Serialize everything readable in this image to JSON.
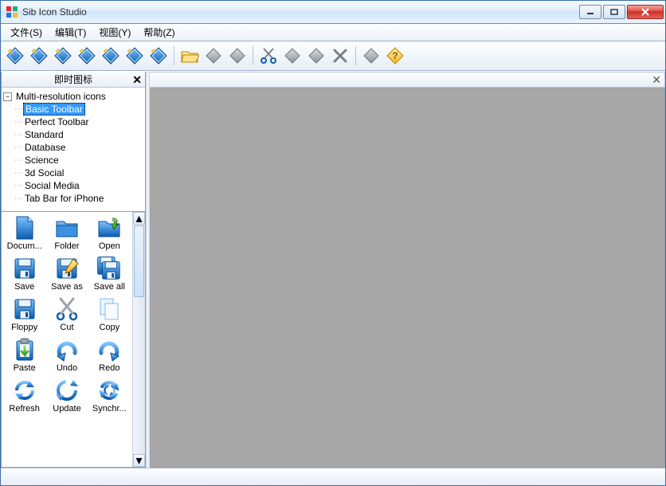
{
  "window": {
    "title": "Sib Icon Studio"
  },
  "menus": [
    {
      "label": "文件(S)"
    },
    {
      "label": "编辑(T)"
    },
    {
      "label": "视图(Y)"
    },
    {
      "label": "帮助(Z)"
    }
  ],
  "toolbar_groups": [
    [
      "new-diamond-1",
      "new-diamond-2",
      "new-diamond-3",
      "new-diamond-4",
      "new-diamond-5",
      "new-diamond-6",
      "new-diamond-7"
    ],
    [
      "open-folder",
      "save-gray-1",
      "save-gray-2"
    ],
    [
      "cut",
      "copy",
      "paste",
      "delete"
    ],
    [
      "properties",
      "help-diamond"
    ]
  ],
  "left_panel": {
    "title": "即时图标",
    "tree_root": "Multi-resolution icons",
    "tree_items": [
      {
        "label": "Basic Toolbar",
        "selected": true
      },
      {
        "label": "Perfect Toolbar"
      },
      {
        "label": "Standard"
      },
      {
        "label": "Database"
      },
      {
        "label": "Science"
      },
      {
        "label": "3d Social"
      },
      {
        "label": "Social Media"
      },
      {
        "label": "Tab Bar for iPhone"
      }
    ],
    "icons": [
      {
        "label": "Docum...",
        "kind": "document"
      },
      {
        "label": "Folder",
        "kind": "folder"
      },
      {
        "label": "Open",
        "kind": "open"
      },
      {
        "label": "Save",
        "kind": "save"
      },
      {
        "label": "Save as",
        "kind": "saveas"
      },
      {
        "label": "Save all",
        "kind": "saveall"
      },
      {
        "label": "Floppy",
        "kind": "floppy"
      },
      {
        "label": "Cut",
        "kind": "scissors"
      },
      {
        "label": "Copy",
        "kind": "copy"
      },
      {
        "label": "Paste",
        "kind": "paste"
      },
      {
        "label": "Undo",
        "kind": "undo"
      },
      {
        "label": "Redo",
        "kind": "redo"
      },
      {
        "label": "Refresh",
        "kind": "refresh"
      },
      {
        "label": "Update",
        "kind": "update"
      },
      {
        "label": "Synchr...",
        "kind": "sync"
      }
    ]
  },
  "colors": {
    "accent": "#3399ff",
    "icon_blue": "#1e6fc4",
    "icon_blue_light": "#5aa8ef",
    "icon_gray": "#9ea4ac"
  }
}
